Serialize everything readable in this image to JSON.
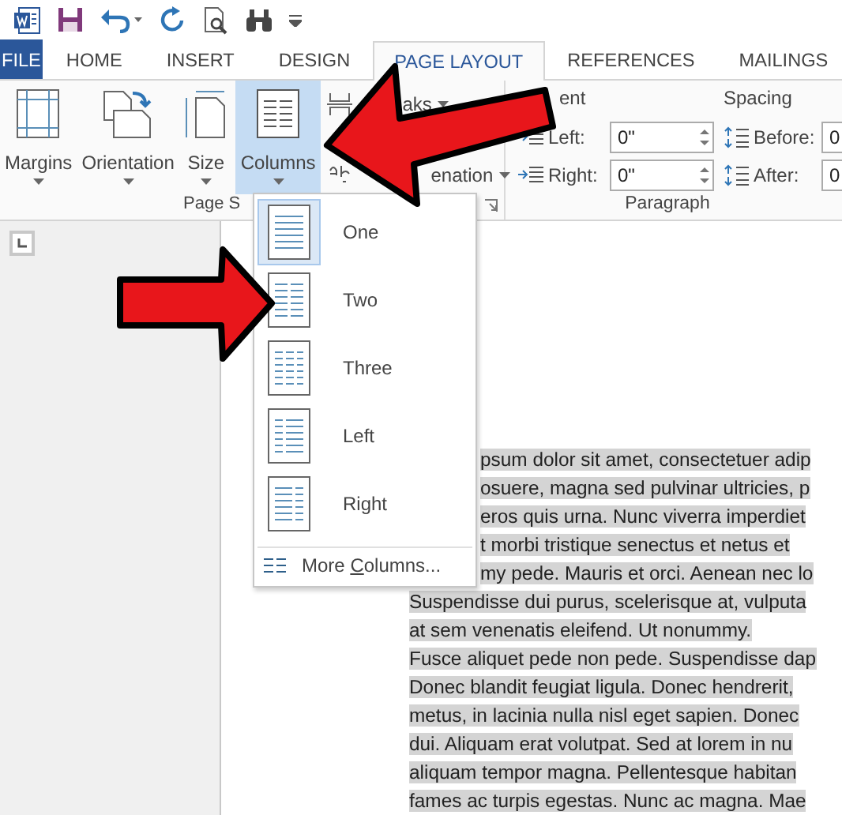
{
  "tabs": [
    {
      "label": "FILE",
      "kind": "file",
      "selected": false
    },
    {
      "label": "HOME",
      "kind": "tab",
      "selected": false
    },
    {
      "label": "INSERT",
      "kind": "tab",
      "selected": false
    },
    {
      "label": "DESIGN",
      "kind": "tab",
      "selected": false
    },
    {
      "label": "PAGE LAYOUT",
      "kind": "tab",
      "selected": true
    },
    {
      "label": "REFERENCES",
      "kind": "tab",
      "selected": false
    },
    {
      "label": "MAILINGS",
      "kind": "tab",
      "selected": false
    }
  ],
  "page_setup": {
    "label": "Page S",
    "big_buttons": [
      {
        "label": "Margins",
        "kind": "margins",
        "expanded": false
      },
      {
        "label": "Orientation",
        "kind": "orientation",
        "expanded": false
      },
      {
        "label": "Size",
        "kind": "size",
        "expanded": false
      },
      {
        "label": "Columns",
        "kind": "columns",
        "expanded": true
      }
    ],
    "small_buttons": [
      {
        "label": "aks",
        "kind": "breaks",
        "dropdown": true
      },
      {
        "label": "enation",
        "kind": "hyphenation",
        "dropdown": true
      }
    ]
  },
  "paragraph": {
    "label": "Paragraph",
    "indent_heading": "ent",
    "spacing_heading": "Spacing",
    "indent_fields": [
      {
        "label": "Left:",
        "value": "0\""
      },
      {
        "label": "Right:",
        "value": "0\""
      }
    ],
    "spacing_fields": [
      {
        "label": "Before:",
        "value": "0"
      },
      {
        "label": "After:",
        "value": "0"
      }
    ]
  },
  "columns_menu": {
    "items": [
      {
        "label": "One",
        "kind": "one",
        "selected": true
      },
      {
        "label": "Two",
        "kind": "two",
        "selected": false
      },
      {
        "label": "Three",
        "kind": "three",
        "selected": false
      },
      {
        "label": "Left",
        "kind": "left",
        "selected": false
      },
      {
        "label": "Right",
        "kind": "right",
        "selected": false
      }
    ],
    "more": {
      "before": "More ",
      "accel": "C",
      "after": "olumns..."
    }
  },
  "document": {
    "lines_beside_menu": [
      "psum dolor sit amet, consectetuer adip",
      "osuere, magna sed pulvinar ultricies, p",
      "eros quis urna. Nunc viverra imperdiet",
      "t morbi tristique senectus et netus et",
      "my pede. Mauris et orci. Aenean nec lo"
    ],
    "lines": [
      "Suspendisse dui purus, scelerisque at, vulputa",
      "at sem venenatis eleifend. Ut nonummy.",
      "Fusce aliquet pede non pede. Suspendisse dap",
      "Donec blandit feugiat ligula. Donec hendrerit,",
      "metus, in lacinia nulla nisl eget sapien. Donec",
      "dui. Aliquam erat volutpat. Sed at lorem in nu",
      "aliquam tempor magna. Pellentesque habitan",
      "fames ac turpis egestas. Nunc ac magna. Mae"
    ]
  }
}
